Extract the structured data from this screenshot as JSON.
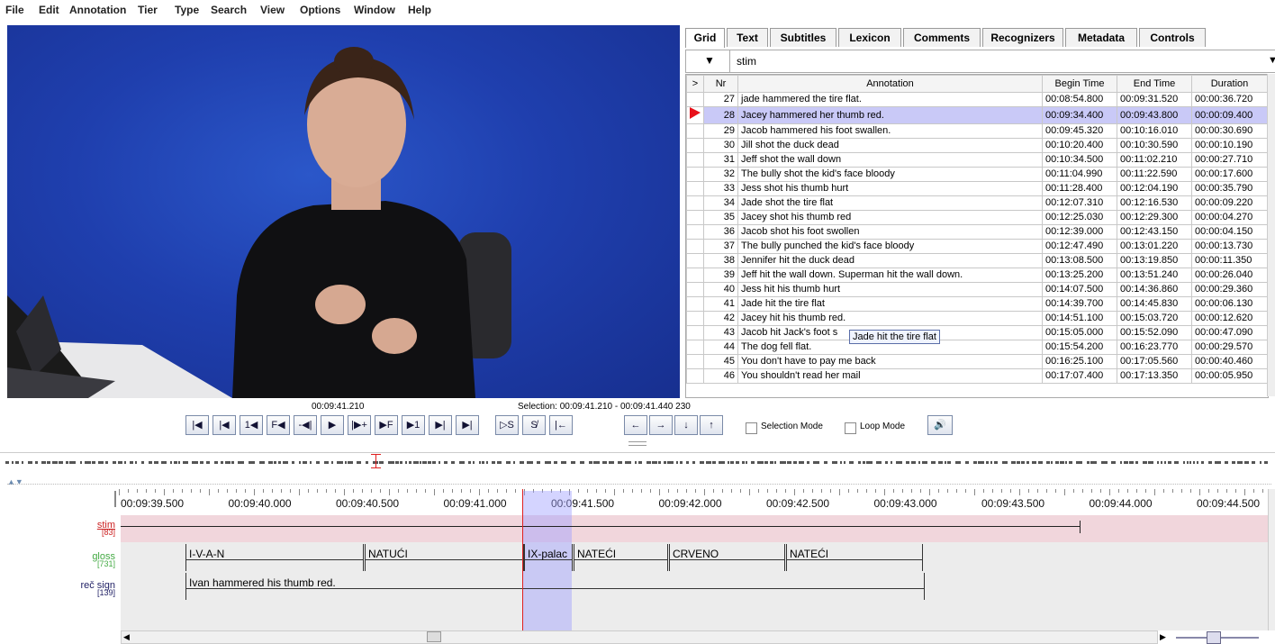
{
  "menu": {
    "items": [
      "File",
      "Edit",
      "Annotation",
      "Tier",
      "Type",
      "Search",
      "View",
      "Options",
      "Window",
      "Help"
    ]
  },
  "grid": {
    "tabs": [
      "Grid",
      "Text",
      "Subtitles",
      "Lexicon",
      "Comments",
      "Recognizers",
      "Metadata",
      "Controls"
    ],
    "active_tab": "Grid",
    "tier_name": "stim",
    "columns": [
      ">",
      "Nr",
      "Annotation",
      "Begin Time",
      "End Time",
      "Duration"
    ],
    "selected_nr": "28",
    "rows": [
      {
        "nr": "27",
        "annotation": "jade hammered the tire flat.",
        "begin": "00:08:54.800",
        "end": "00:09:31.520",
        "duration": "00:00:36.720"
      },
      {
        "nr": "28",
        "annotation": "Jacey hammered her thumb red.",
        "begin": "00:09:34.400",
        "end": "00:09:43.800",
        "duration": "00:00:09.400"
      },
      {
        "nr": "29",
        "annotation": "Jacob hammered his foot swallen.",
        "begin": "00:09:45.320",
        "end": "00:10:16.010",
        "duration": "00:00:30.690"
      },
      {
        "nr": "30",
        "annotation": "Jill shot the duck dead",
        "begin": "00:10:20.400",
        "end": "00:10:30.590",
        "duration": "00:00:10.190"
      },
      {
        "nr": "31",
        "annotation": "Jeff shot the wall down",
        "begin": "00:10:34.500",
        "end": "00:11:02.210",
        "duration": "00:00:27.710"
      },
      {
        "nr": "32",
        "annotation": "The bully shot the kid's face bloody",
        "begin": "00:11:04.990",
        "end": "00:11:22.590",
        "duration": "00:00:17.600"
      },
      {
        "nr": "33",
        "annotation": "Jess shot his thumb hurt",
        "begin": "00:11:28.400",
        "end": "00:12:04.190",
        "duration": "00:00:35.790"
      },
      {
        "nr": "34",
        "annotation": "Jade shot the tire flat",
        "begin": "00:12:07.310",
        "end": "00:12:16.530",
        "duration": "00:00:09.220"
      },
      {
        "nr": "35",
        "annotation": "Jacey shot his thumb red",
        "begin": "00:12:25.030",
        "end": "00:12:29.300",
        "duration": "00:00:04.270"
      },
      {
        "nr": "36",
        "annotation": "Jacob shot his foot swollen",
        "begin": "00:12:39.000",
        "end": "00:12:43.150",
        "duration": "00:00:04.150"
      },
      {
        "nr": "37",
        "annotation": "The bully punched the kid's face bloody",
        "begin": "00:12:47.490",
        "end": "00:13:01.220",
        "duration": "00:00:13.730"
      },
      {
        "nr": "38",
        "annotation": "Jennifer hit the duck dead",
        "begin": "00:13:08.500",
        "end": "00:13:19.850",
        "duration": "00:00:11.350"
      },
      {
        "nr": "39",
        "annotation": "Jeff hit the wall down. Superman hit the wall down.",
        "begin": "00:13:25.200",
        "end": "00:13:51.240",
        "duration": "00:00:26.040"
      },
      {
        "nr": "40",
        "annotation": "Jess hit his thumb hurt",
        "begin": "00:14:07.500",
        "end": "00:14:36.860",
        "duration": "00:00:29.360"
      },
      {
        "nr": "41",
        "annotation": "Jade hit the tire flat",
        "begin": "00:14:39.700",
        "end": "00:14:45.830",
        "duration": "00:00:06.130"
      },
      {
        "nr": "42",
        "annotation": "Jacey hit his thumb red.",
        "begin": "00:14:51.100",
        "end": "00:15:03.720",
        "duration": "00:00:12.620"
      },
      {
        "nr": "43",
        "annotation": "Jacob hit Jack's foot s",
        "begin": "00:15:05.000",
        "end": "00:15:52.090",
        "duration": "00:00:47.090"
      },
      {
        "nr": "44",
        "annotation": "The dog fell flat.",
        "begin": "00:15:54.200",
        "end": "00:16:23.770",
        "duration": "00:00:29.570"
      },
      {
        "nr": "45",
        "annotation": "You don't have to pay me back",
        "begin": "00:16:25.100",
        "end": "00:17:05.560",
        "duration": "00:00:40.460"
      },
      {
        "nr": "46",
        "annotation": "You shouldn't read her mail",
        "begin": "00:17:07.400",
        "end": "00:17:13.350",
        "duration": "00:00:05.950"
      }
    ],
    "tooltip": "Jade hit the tire flat"
  },
  "media": {
    "current_time": "00:09:41.210",
    "selection": "Selection: 00:09:41.210 - 00:09:41.440  230"
  },
  "controls": {
    "buttons": [
      "|◀",
      "|◀",
      "1◀",
      "F◀",
      "-◀|",
      "▶",
      "|▶+",
      "▶F",
      "▶1",
      "▶|",
      "▶|"
    ],
    "sel_buttons": [
      "▷S",
      "S̸",
      "|←"
    ],
    "arrow_buttons": [
      "←",
      "→",
      "↓",
      "↑"
    ],
    "selection_mode_label": "Selection Mode",
    "loop_mode_label": "Loop Mode",
    "volume_icon": "speaker-icon"
  },
  "timeline": {
    "ruler_labels": [
      "00:09:39.500",
      "00:09:40.000",
      "00:09:40.500",
      "00:09:41.000",
      "00:09:41.500",
      "00:09:42.000",
      "00:09:42.500",
      "00:09:43.000",
      "00:09:43.500",
      "00:09:44.000",
      "00:09:44.500"
    ],
    "tiers": [
      {
        "name": "stim",
        "count": "[83]",
        "color": "#cc2222"
      },
      {
        "name": "gloss",
        "count": "[731]",
        "color": "#44aa44"
      },
      {
        "name": "reč sign",
        "count": "[139]",
        "color": "#222266"
      }
    ],
    "gloss_annotations": [
      "I-V-A-N",
      "NATUĆI",
      "IX-palac",
      "NATEĆI",
      "CRVENO",
      "NATEĆI"
    ],
    "rec_annotation": "Ivan hammered his thumb red."
  }
}
